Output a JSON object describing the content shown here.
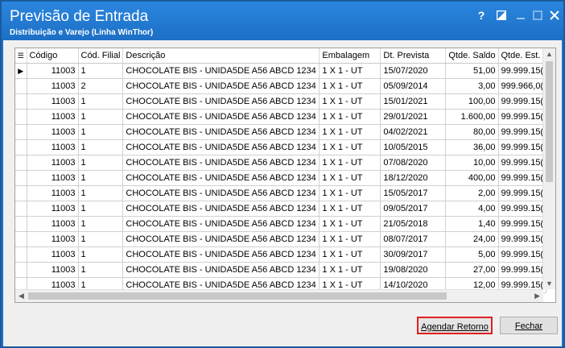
{
  "window": {
    "title": "Previsão de Entrada",
    "subtitle": "Distribuição e Varejo (Linha WinThor)",
    "help": "?"
  },
  "grid": {
    "columns": [
      "Código",
      "Cód. Filial",
      "Descrição",
      "Embalagem",
      "Dt. Prevista",
      "Qtde. Saldo",
      "Qtde. Est."
    ],
    "rows": [
      [
        "11003",
        "1",
        "CHOCOLATE BIS - UNIDA5DE A56 ABCD 1234",
        "1 X 1 - UT",
        "15/07/2020",
        "51,00",
        "99.999.15("
      ],
      [
        "11003",
        "2",
        "CHOCOLATE BIS - UNIDA5DE A56 ABCD 1234",
        "1 X 1 - UT",
        "05/09/2014",
        "3,00",
        "999.966,0("
      ],
      [
        "11003",
        "1",
        "CHOCOLATE BIS - UNIDA5DE A56 ABCD 1234",
        "1 X 1 - UT",
        "15/01/2021",
        "100,00",
        "99.999.15("
      ],
      [
        "11003",
        "1",
        "CHOCOLATE BIS - UNIDA5DE A56 ABCD 1234",
        "1 X 1 - UT",
        "29/01/2021",
        "1.600,00",
        "99.999.15("
      ],
      [
        "11003",
        "1",
        "CHOCOLATE BIS - UNIDA5DE A56 ABCD 1234",
        "1 X 1 - UT",
        "04/02/2021",
        "80,00",
        "99.999.15("
      ],
      [
        "11003",
        "1",
        "CHOCOLATE BIS - UNIDA5DE A56 ABCD 1234",
        "1 X 1 - UT",
        "10/05/2015",
        "36,00",
        "99.999.15("
      ],
      [
        "11003",
        "1",
        "CHOCOLATE BIS - UNIDA5DE A56 ABCD 1234",
        "1 X 1 - UT",
        "07/08/2020",
        "10,00",
        "99.999.15("
      ],
      [
        "11003",
        "1",
        "CHOCOLATE BIS - UNIDA5DE A56 ABCD 1234",
        "1 X 1 - UT",
        "18/12/2020",
        "400,00",
        "99.999.15("
      ],
      [
        "11003",
        "1",
        "CHOCOLATE BIS - UNIDA5DE A56 ABCD 1234",
        "1 X 1 - UT",
        "15/05/2017",
        "2,00",
        "99.999.15("
      ],
      [
        "11003",
        "1",
        "CHOCOLATE BIS - UNIDA5DE A56 ABCD 1234",
        "1 X 1 - UT",
        "09/05/2017",
        "4,00",
        "99.999.15("
      ],
      [
        "11003",
        "1",
        "CHOCOLATE BIS - UNIDA5DE A56 ABCD 1234",
        "1 X 1 - UT",
        "21/05/2018",
        "1,40",
        "99.999.15("
      ],
      [
        "11003",
        "1",
        "CHOCOLATE BIS - UNIDA5DE A56 ABCD 1234",
        "1 X 1 - UT",
        "08/07/2017",
        "24,00",
        "99.999.15("
      ],
      [
        "11003",
        "1",
        "CHOCOLATE BIS - UNIDA5DE A56 ABCD 1234",
        "1 X 1 - UT",
        "30/09/2017",
        "5,00",
        "99.999.15("
      ],
      [
        "11003",
        "1",
        "CHOCOLATE BIS - UNIDA5DE A56 ABCD 1234",
        "1 X 1 - UT",
        "19/08/2020",
        "27,00",
        "99.999.15("
      ],
      [
        "11003",
        "1",
        "CHOCOLATE BIS - UNIDA5DE A56 ABCD 1234",
        "1 X 1 - UT",
        "14/10/2020",
        "12,00",
        "99.999.15("
      ]
    ]
  },
  "buttons": {
    "agendar": "Agendar Retorno",
    "fechar": "Fechar"
  },
  "colors": {
    "titlebar": "#1e73c9",
    "highlight_border": "#e02020"
  }
}
